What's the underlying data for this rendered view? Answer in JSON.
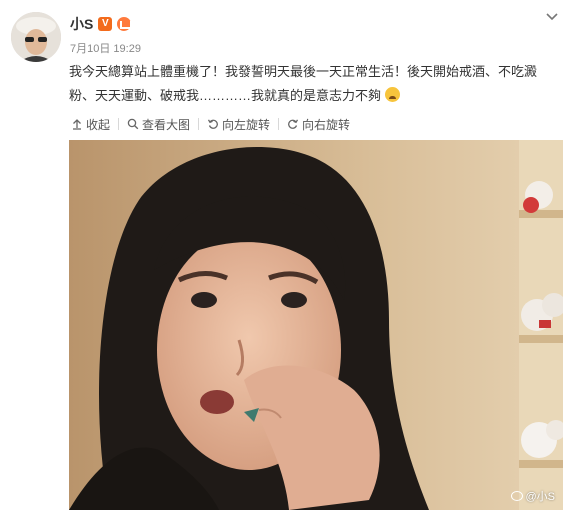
{
  "post": {
    "user_name": "小S",
    "verified_badge": "V",
    "timestamp": "7月10日 19:29",
    "text": "我今天總算站上體重機了！我發誓明天最後一天正常生活！後天開始戒酒、不吃澱粉、天天運動、破戒我…………我就真的是意志力不夠",
    "emoji": "tired-face-emoji"
  },
  "toolbar": {
    "collapse_label": "收起",
    "view_large_label": "查看大图",
    "rotate_left_label": "向左旋转",
    "rotate_right_label": "向右旋转"
  },
  "photo": {
    "watermark": "@小S"
  },
  "colors": {
    "badge_orange": "#f36b1c",
    "text": "#333333",
    "meta": "#888888"
  }
}
